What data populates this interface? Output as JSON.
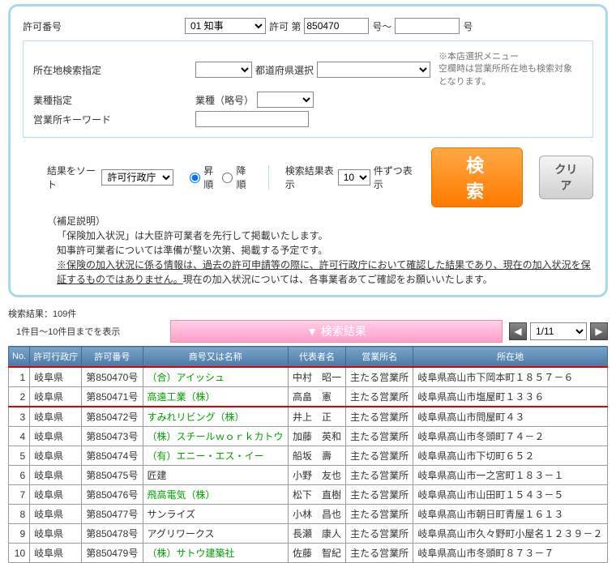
{
  "form": {
    "permit_no_label": "許可番号",
    "permit_type_options": [
      "01 知事"
    ],
    "permit_prefix": "許可 第",
    "permit_value": "850470",
    "permit_suffix1": "号～",
    "permit_suffix2": "号",
    "location_label": "所在地検索指定",
    "pref_label": "都道府県選択",
    "industry_label": "業種指定",
    "industry_prefix": "業種（略号）",
    "keyword_label": "営業所キーワード",
    "note_lines": [
      "※本店選択メニュー",
      "空欄時は営業所所在地も検索対象",
      "となります。"
    ],
    "sort_label": "結果をソート",
    "sort_options": [
      "許可行政庁"
    ],
    "asc_label": "昇順",
    "desc_label": "降順",
    "result_count_label": "検索結果表示",
    "count_options": [
      "10"
    ],
    "per_page_suffix": "件ずつ表示",
    "search_btn": "検 索",
    "clear_btn": "クリア",
    "supplement_title": "（補足説明）",
    "supp1": "「保険加入状況」は大臣許可業者を先行して掲載いたします。",
    "supp2": "知事許可業者については準備が整い次第、掲載する予定です。",
    "supp3": "※保険の加入状況に係る情報は、過去の許可申請等の際に、許可行政庁において確認した結果であり、現在の加入状況を保証するものではありません。",
    "supp3b": "現在の加入状況については、各事業者あてご確認をお願いいたします。"
  },
  "results": {
    "meta1": "検索結果：109件",
    "meta2": "1件目～10件目までを表示",
    "banner": "▼ 検索結果",
    "page_options": [
      "1/11"
    ],
    "columns": [
      "No.",
      "許可行政庁",
      "許可番号",
      "商号又は名称",
      "代表者名",
      "営業所名",
      "所在地"
    ],
    "rows": [
      {
        "no": "1",
        "pref": "岐阜県",
        "num": "第850470号",
        "name": "（合）アイッシュ",
        "name_green": true,
        "rep": "中村　昭一",
        "office": "主たる営業所",
        "addr": "岐阜県高山市下岡本町１８５７－６"
      },
      {
        "no": "2",
        "pref": "岐阜県",
        "num": "第850471号",
        "name": "高遠工業（株）",
        "name_green": true,
        "rep": "高畠　憲",
        "office": "主たる営業所",
        "addr": "岐阜県高山市塩屋町１３３６"
      },
      {
        "no": "3",
        "pref": "岐阜県",
        "num": "第850472号",
        "name": "すみれリビング（株）",
        "name_green": true,
        "rep": "井上　正",
        "office": "主たる営業所",
        "addr": "岐阜県高山市問屋町４３"
      },
      {
        "no": "4",
        "pref": "岐阜県",
        "num": "第850473号",
        "name": "（株）スチールｗｏｒｋカトウ",
        "name_green": true,
        "rep": "加藤　英和",
        "office": "主たる営業所",
        "addr": "岐阜県高山市冬頭町７４－２"
      },
      {
        "no": "5",
        "pref": "岐阜県",
        "num": "第850474号",
        "name": "（有）エニー・エス・イー",
        "name_green": true,
        "rep": "船坂　壽",
        "office": "主たる営業所",
        "addr": "岐阜県高山市下切町６５２"
      },
      {
        "no": "6",
        "pref": "岐阜県",
        "num": "第850475号",
        "name": "匠建",
        "name_green": false,
        "rep": "小野　友也",
        "office": "主たる営業所",
        "addr": "岐阜県高山市一之宮町１８３－１"
      },
      {
        "no": "7",
        "pref": "岐阜県",
        "num": "第850476号",
        "name": "飛高電気（株）",
        "name_green": true,
        "rep": "松下　直樹",
        "office": "主たる営業所",
        "addr": "岐阜県高山市山田町１５４３－５"
      },
      {
        "no": "8",
        "pref": "岐阜県",
        "num": "第850477号",
        "name": "サンライズ",
        "name_green": false,
        "rep": "小林　昌也",
        "office": "主たる営業所",
        "addr": "岐阜県高山市朝日町青屋１６１３"
      },
      {
        "no": "9",
        "pref": "岐阜県",
        "num": "第850478号",
        "name": "アグリワークス",
        "name_green": false,
        "rep": "長瀬　康人",
        "office": "主たる営業所",
        "addr": "岐阜県高山市久々野町小屋名１２３９－２"
      },
      {
        "no": "10",
        "pref": "岐阜県",
        "num": "第850479号",
        "name": "（株）サトウ建築社",
        "name_green": true,
        "rep": "佐藤　智紀",
        "office": "主たる営業所",
        "addr": "岐阜県高山市冬頭町８７３－７"
      }
    ]
  }
}
